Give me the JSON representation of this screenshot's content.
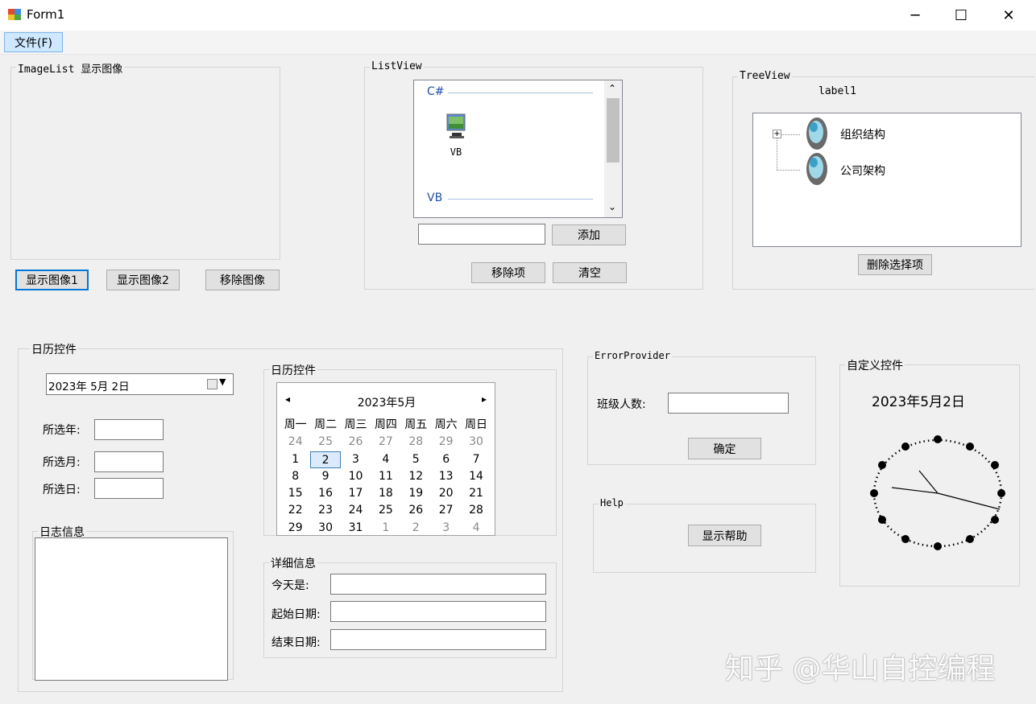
{
  "window": {
    "title": "Form1",
    "minimize": "─",
    "maximize": "☐",
    "close": "✕",
    "icon": "form-app-icon"
  },
  "menu": {
    "file": "文件(F)"
  },
  "imagelist": {
    "label": "ImageList 显示图像",
    "btn1": "显示图像1",
    "btn2": "显示图像2",
    "btn3": "移除图像"
  },
  "listview": {
    "label": "ListView",
    "group1": "C#",
    "item1": "VB",
    "group2": "VB",
    "add": "添加",
    "remove": "移除项",
    "clear": "清空",
    "input_value": ""
  },
  "treeview": {
    "label": "TreeView",
    "label1": "label1",
    "nodes": [
      "组织结构",
      "公司架构"
    ],
    "delete": "删除选择项"
  },
  "calendar_group": {
    "label": "日历控件",
    "date_value": "2023年 5月 2日",
    "year_label": "所选年:",
    "month_label": "所选月:",
    "day_label": "所选日:",
    "log_label": "日志信息"
  },
  "month_calendar": {
    "label": "日历控件",
    "title": "2023年5月",
    "prev": "◂",
    "next": "▸",
    "weekdays": [
      "周一",
      "周二",
      "周三",
      "周四",
      "周五",
      "周六",
      "周日"
    ],
    "weeks": [
      [
        "24",
        "25",
        "26",
        "27",
        "28",
        "29",
        "30"
      ],
      [
        "1",
        "2",
        "3",
        "4",
        "5",
        "6",
        "7"
      ],
      [
        "8",
        "9",
        "10",
        "11",
        "12",
        "13",
        "14"
      ],
      [
        "15",
        "16",
        "17",
        "18",
        "19",
        "20",
        "21"
      ],
      [
        "22",
        "23",
        "24",
        "25",
        "26",
        "27",
        "28"
      ],
      [
        "29",
        "30",
        "31",
        "1",
        "2",
        "3",
        "4"
      ]
    ]
  },
  "details": {
    "label": "详细信息",
    "today": "今天是:",
    "start": "起始日期:",
    "end": "结束日期:"
  },
  "errorprovider": {
    "label": "ErrorProvider",
    "count_label": "班级人数:",
    "ok": "确定"
  },
  "help": {
    "label": "Help",
    "show": "显示帮助"
  },
  "custom": {
    "label": "自定义控件",
    "date": "2023年5月2日"
  },
  "watermark": "知乎 @华山自控编程"
}
